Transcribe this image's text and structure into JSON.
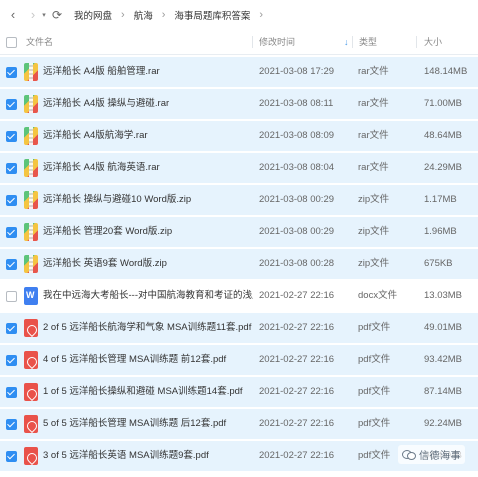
{
  "breadcrumb": [
    "我的网盘",
    "航海",
    "海事局题库积答案"
  ],
  "columns": {
    "name": "文件名",
    "modified": "修改时间",
    "type": "类型",
    "size": "大小"
  },
  "files": [
    {
      "name": "远洋船长 A4版 船舶管理.rar",
      "time": "2021-03-08 17:29",
      "type": "rar文件",
      "size": "148.14MB",
      "icon": "rar-archive-icon",
      "checked": true
    },
    {
      "name": "远洋船长 A4版 操纵与避碰.rar",
      "time": "2021-03-08 08:11",
      "type": "rar文件",
      "size": "71.00MB",
      "icon": "rar-archive-icon",
      "checked": true
    },
    {
      "name": "远洋船长 A4版航海学.rar",
      "time": "2021-03-08 08:09",
      "type": "rar文件",
      "size": "48.64MB",
      "icon": "rar-archive-icon",
      "checked": true
    },
    {
      "name": "远洋船长 A4版 航海英语.rar",
      "time": "2021-03-08 08:04",
      "type": "rar文件",
      "size": "24.29MB",
      "icon": "rar-archive-icon",
      "checked": true
    },
    {
      "name": "远洋船长  操纵与避碰10    Word版.zip",
      "time": "2021-03-08 00:29",
      "type": "zip文件",
      "size": "1.17MB",
      "icon": "zip-archive-icon",
      "checked": true
    },
    {
      "name": "远洋船长  管理20套    Word版.zip",
      "time": "2021-03-08 00:29",
      "type": "zip文件",
      "size": "1.96MB",
      "icon": "zip-archive-icon",
      "checked": true
    },
    {
      "name": "远洋船长 英语9套  Word版.zip",
      "time": "2021-03-08 00:28",
      "type": "zip文件",
      "size": "675KB",
      "icon": "zip-archive-icon",
      "checked": true
    },
    {
      "name": "我在中远海大考船长---对中国航海教育和考证的浅显思考...",
      "time": "2021-02-27 22:16",
      "type": "docx文件",
      "size": "13.03MB",
      "icon": "word-doc-icon",
      "checked": false
    },
    {
      "name": "2 of 5 远洋船长航海学和气象 MSA训练题11套.pdf",
      "time": "2021-02-27 22:16",
      "type": "pdf文件",
      "size": "49.01MB",
      "icon": "pdf-file-icon",
      "checked": true
    },
    {
      "name": "4 of 5 远洋船长管理   MSA训练题 前12套.pdf",
      "time": "2021-02-27 22:16",
      "type": "pdf文件",
      "size": "93.42MB",
      "icon": "pdf-file-icon",
      "checked": true
    },
    {
      "name": "1 of 5 远洋船长操纵和避碰   MSA训练题14套.pdf",
      "time": "2021-02-27 22:16",
      "type": "pdf文件",
      "size": "87.14MB",
      "icon": "pdf-file-icon",
      "checked": true
    },
    {
      "name": "5 of 5 远洋船长管理   MSA训练题 后12套.pdf",
      "time": "2021-02-27 22:16",
      "type": "pdf文件",
      "size": "92.24MB",
      "icon": "pdf-file-icon",
      "checked": true
    },
    {
      "name": "3 of 5 远洋船长英语  MSA训练题9套.pdf",
      "time": "2021-02-27 22:16",
      "type": "pdf文件",
      "size": "98.45MB",
      "icon": "pdf-file-icon",
      "checked": true
    }
  ],
  "watermark": "信德海事",
  "colors": {
    "accent": "#2f8ef2",
    "selected_row": "#e6f3fd",
    "pdf": "#e9524a",
    "doc": "#3f7ff0"
  }
}
